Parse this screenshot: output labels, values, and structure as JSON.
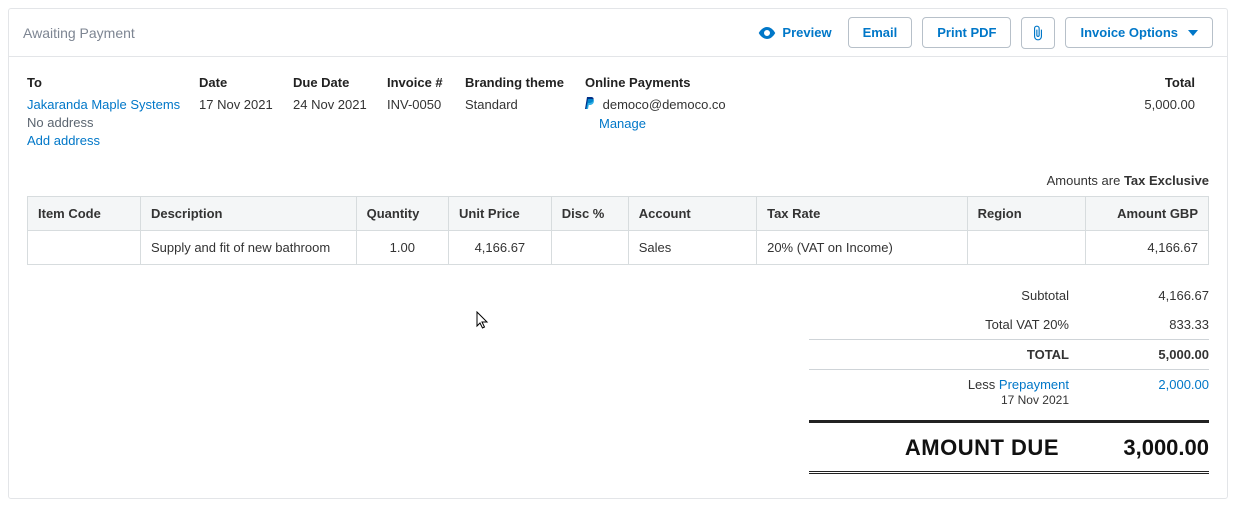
{
  "status": "Awaiting Payment",
  "actions": {
    "preview": "Preview",
    "email": "Email",
    "print": "Print PDF",
    "options": "Invoice Options"
  },
  "header": {
    "labels": {
      "to": "To",
      "date": "Date",
      "due_date": "Due Date",
      "invoice_no": "Invoice #",
      "branding": "Branding theme",
      "online_payments": "Online Payments",
      "total": "Total"
    },
    "to_name": "Jakaranda Maple Systems",
    "to_address_line": "No address",
    "add_address": "Add address",
    "date": "17 Nov 2021",
    "due_date": "24 Nov 2021",
    "invoice_no": "INV-0050",
    "branding": "Standard",
    "online_payments_email": "democo@democo.co",
    "online_payments_manage": "Manage",
    "total": "5,000.00"
  },
  "amounts_note_prefix": "Amounts are ",
  "amounts_note_value": "Tax Exclusive",
  "columns": {
    "item_code": "Item Code",
    "description": "Description",
    "quantity": "Quantity",
    "unit_price": "Unit Price",
    "disc": "Disc %",
    "account": "Account",
    "tax_rate": "Tax Rate",
    "region": "Region",
    "amount": "Amount GBP"
  },
  "line": {
    "item_code": "",
    "description": "Supply and fit of new bathroom",
    "quantity": "1.00",
    "unit_price": "4,166.67",
    "disc": "",
    "account": "Sales",
    "tax_rate": "20% (VAT on Income)",
    "region": "",
    "amount": "4,166.67"
  },
  "totals": {
    "subtotal_label": "Subtotal",
    "subtotal": "4,166.67",
    "vat_label": "Total VAT  20%",
    "vat": "833.33",
    "total_label": "TOTAL",
    "total": "5,000.00",
    "less_label_prefix": "Less ",
    "less_label_link": "Prepayment",
    "less_date": "17 Nov 2021",
    "less_amount": "2,000.00",
    "amount_due_label": "AMOUNT DUE",
    "amount_due": "3,000.00"
  }
}
